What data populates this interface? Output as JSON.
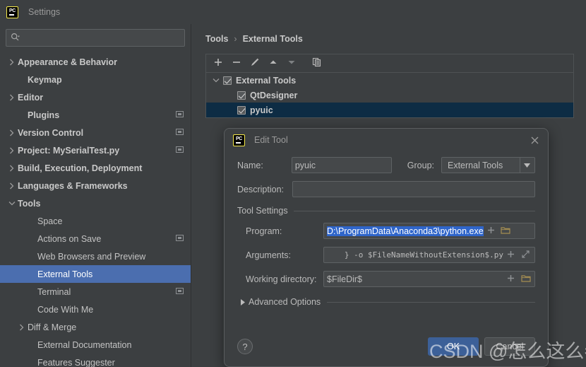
{
  "window": {
    "app_icon": "pycharm-logo-icon",
    "title": "Settings"
  },
  "sidebar": {
    "search": {
      "placeholder": "",
      "value": "",
      "icon": "search-icon"
    },
    "items": [
      {
        "label": "Appearance & Behavior",
        "chevron": "right",
        "indent": 0,
        "bold": true,
        "badge": false,
        "selected": false
      },
      {
        "label": "Keymap",
        "chevron": "none",
        "indent": 1,
        "bold": true,
        "badge": false,
        "selected": false
      },
      {
        "label": "Editor",
        "chevron": "right",
        "indent": 0,
        "bold": true,
        "badge": false,
        "selected": false
      },
      {
        "label": "Plugins",
        "chevron": "none",
        "indent": 1,
        "bold": true,
        "badge": true,
        "selected": false
      },
      {
        "label": "Version Control",
        "chevron": "right",
        "indent": 0,
        "bold": true,
        "badge": true,
        "selected": false
      },
      {
        "label": "Project: MySerialTest.py",
        "chevron": "right",
        "indent": 0,
        "bold": true,
        "badge": true,
        "selected": false
      },
      {
        "label": "Build, Execution, Deployment",
        "chevron": "right",
        "indent": 0,
        "bold": true,
        "badge": false,
        "selected": false
      },
      {
        "label": "Languages & Frameworks",
        "chevron": "right",
        "indent": 0,
        "bold": true,
        "badge": false,
        "selected": false
      },
      {
        "label": "Tools",
        "chevron": "down",
        "indent": 0,
        "bold": true,
        "badge": false,
        "selected": false
      },
      {
        "label": "Space",
        "chevron": "none",
        "indent": 2,
        "bold": false,
        "badge": false,
        "selected": false
      },
      {
        "label": "Actions on Save",
        "chevron": "none",
        "indent": 2,
        "bold": false,
        "badge": true,
        "selected": false
      },
      {
        "label": "Web Browsers and Preview",
        "chevron": "none",
        "indent": 2,
        "bold": false,
        "badge": false,
        "selected": false
      },
      {
        "label": "External Tools",
        "chevron": "none",
        "indent": 2,
        "bold": false,
        "badge": false,
        "selected": true
      },
      {
        "label": "Terminal",
        "chevron": "none",
        "indent": 2,
        "bold": false,
        "badge": true,
        "selected": false
      },
      {
        "label": "Code With Me",
        "chevron": "none",
        "indent": 2,
        "bold": false,
        "badge": false,
        "selected": false
      },
      {
        "label": "Diff & Merge",
        "chevron": "right",
        "indent": 1,
        "bold": false,
        "badge": false,
        "selected": false
      },
      {
        "label": "External Documentation",
        "chevron": "none",
        "indent": 2,
        "bold": false,
        "badge": false,
        "selected": false
      },
      {
        "label": "Features Suggester",
        "chevron": "none",
        "indent": 2,
        "bold": false,
        "badge": false,
        "selected": false
      }
    ]
  },
  "main": {
    "breadcrumb": {
      "parent": "Tools",
      "separator": "›",
      "current": "External Tools"
    },
    "toolbar": [
      {
        "name": "add-tool-button",
        "icon": "plus-icon"
      },
      {
        "name": "remove-tool-button",
        "icon": "minus-icon"
      },
      {
        "name": "edit-tool-button",
        "icon": "pencil-icon"
      },
      {
        "name": "move-up-button",
        "icon": "arrow-up-icon"
      },
      {
        "name": "move-down-button",
        "icon": "arrow-down-icon"
      },
      {
        "name": "copy-tool-button",
        "icon": "copy-icon"
      }
    ],
    "tool_tree": [
      {
        "label": "External Tools",
        "checked": true,
        "chevron": "down",
        "indent": 0,
        "selected": false
      },
      {
        "label": "QtDesigner",
        "checked": true,
        "chevron": "none",
        "indent": 1,
        "selected": false
      },
      {
        "label": "pyuic",
        "checked": true,
        "chevron": "none",
        "indent": 1,
        "selected": true
      }
    ]
  },
  "dialog": {
    "icon": "pycharm-logo-icon",
    "title": "Edit Tool",
    "close_icon": "close-icon",
    "name_label": "Name:",
    "name_value": "pyuic",
    "group_label": "Group:",
    "group_value": "External Tools",
    "group_arrow_icon": "chevron-down-icon",
    "description_label": "Description:",
    "description_value": "",
    "tool_settings_title": "Tool Settings",
    "fields": [
      {
        "label": "Program:",
        "value": "D:\\ProgramData\\Anaconda3\\python.exe",
        "highlighted": true,
        "buttons": [
          {
            "name": "insert-macro-button",
            "icon": "plus-icon"
          },
          {
            "name": "browse-folder-button",
            "icon": "folder-icon"
          }
        ]
      },
      {
        "label": "Arguments:",
        "value": "} -o $FileNameWithoutExtension$.py",
        "highlighted": false,
        "buttons": [
          {
            "name": "insert-macro-button",
            "icon": "plus-icon"
          },
          {
            "name": "expand-editor-button",
            "icon": "expand-icon"
          }
        ]
      },
      {
        "label": "Working directory:",
        "value": "$FileDir$",
        "highlighted": false,
        "buttons": [
          {
            "name": "insert-macro-button",
            "icon": "plus-icon"
          },
          {
            "name": "browse-folder-button",
            "icon": "folder-icon"
          }
        ]
      }
    ],
    "advanced_options_label": "Advanced Options",
    "advanced_options_icon": "triangle-right-icon",
    "help_label": "?",
    "ok_label": "OK",
    "cancel_label": "Cancel"
  },
  "watermark": {
    "text": "CSDN @怎么这么卷啊"
  },
  "colors": {
    "window_bg": "#3c3f41",
    "sidebar_selection": "#4b6eaf",
    "tree_selection": "#0d2c44",
    "text_selection": "#2f65ca",
    "primary_button": "#3c6098",
    "logo_yellow": "#f5e94a"
  }
}
